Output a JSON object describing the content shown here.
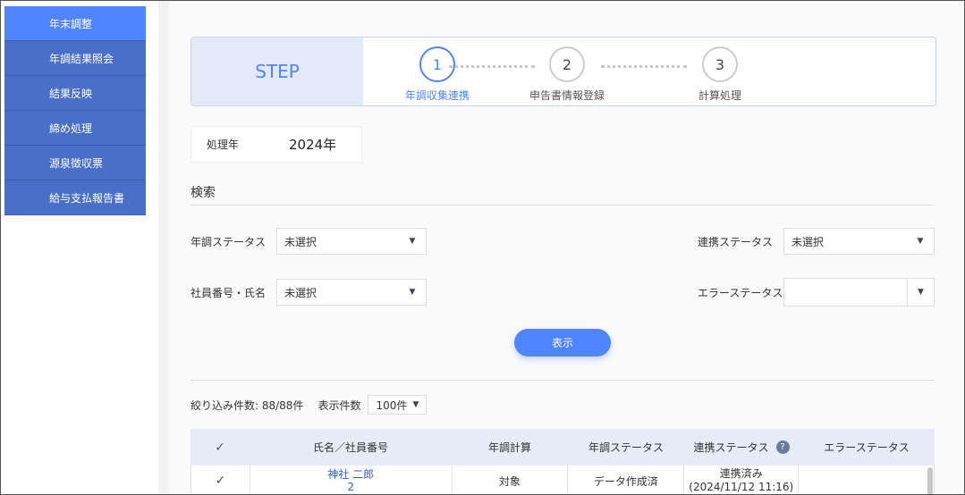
{
  "sidebar": {
    "items": [
      {
        "label": "年末調整",
        "active": true
      },
      {
        "label": "年調結果照会"
      },
      {
        "label": "結果反映"
      },
      {
        "label": "締め処理"
      },
      {
        "label": "源泉徴収票"
      },
      {
        "label": "給与支払報告書"
      }
    ]
  },
  "steps": {
    "label": "STEP",
    "items": [
      {
        "num": "1",
        "caption": "年調収集連携",
        "active": true
      },
      {
        "num": "2",
        "caption": "申告書情報登録"
      },
      {
        "num": "3",
        "caption": "計算処理"
      }
    ]
  },
  "year": {
    "label": "処理年",
    "value": "2024年"
  },
  "search": {
    "title": "検索",
    "nencho_status_label": "年調ステータス",
    "nencho_status_value": "未選択",
    "renkei_status_label": "連携ステータス",
    "renkei_status_value": "未選択",
    "employee_label": "社員番号・氏名",
    "employee_value": "未選択",
    "error_status_label": "エラーステータス",
    "error_status_value": "",
    "show_button": "表示"
  },
  "filter": {
    "count_text": "絞り込み件数: 88/88件",
    "per_page_label": "表示件数",
    "per_page_value": "100件"
  },
  "table": {
    "headers": [
      "✓",
      "氏名／社員番号",
      "年調計算",
      "年調ステータス",
      "連携ステータス",
      "エラーステータス"
    ],
    "rows": [
      {
        "check": "✓",
        "name": "神社 二郎",
        "number": "2",
        "calc": "対象",
        "nencho_status": "データ作成済",
        "renkei_status": "連携済み (2024/11/12 11:16)",
        "error_status": ""
      }
    ]
  },
  "colors": {
    "accent": "#4f86ff",
    "sidebar": "#4a6fc9"
  }
}
